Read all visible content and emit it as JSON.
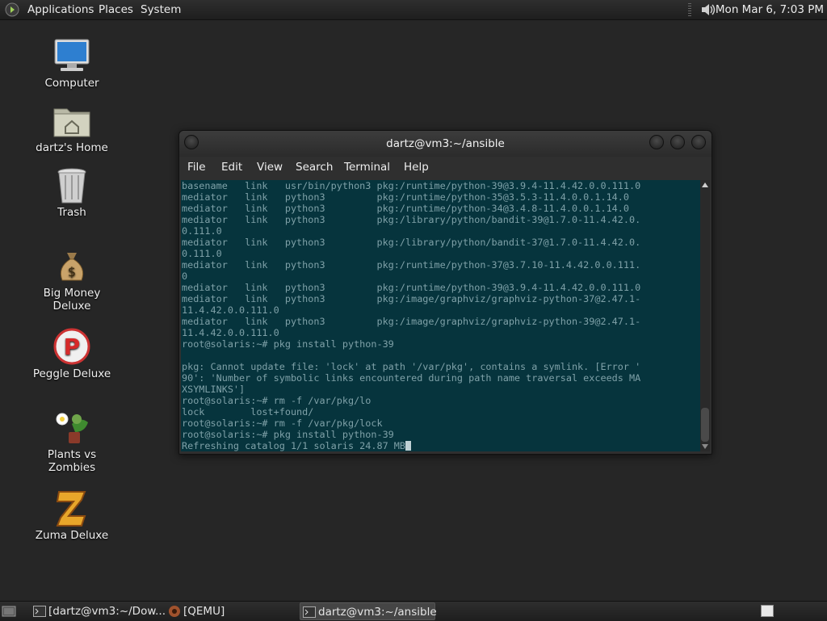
{
  "top_panel": {
    "menus": [
      "Applications",
      "Places",
      "System"
    ],
    "clock": "Mon Mar  6,  7:03 PM"
  },
  "desktop_icons": [
    {
      "label": "Computer",
      "icon": "computer-icon"
    },
    {
      "label": "dartz's Home",
      "icon": "home-folder-icon"
    },
    {
      "label": "Trash",
      "icon": "trash-icon"
    },
    {
      "label": "Big Money Deluxe",
      "icon": "money-bag-icon"
    },
    {
      "label": "Peggle Deluxe",
      "icon": "peggle-icon"
    },
    {
      "label": "Plants vs Zombies",
      "icon": "plants-vs-zombies-icon"
    },
    {
      "label": "Zuma Deluxe",
      "icon": "zuma-icon"
    }
  ],
  "terminal": {
    "title": "dartz@vm3:~/ansible",
    "menu": [
      "File",
      "Edit",
      "View",
      "Search",
      "Terminal",
      "Help"
    ],
    "lines": [
      "basename   link   usr/bin/python3 pkg:/runtime/python-39@3.9.4-11.4.42.0.0.111.0",
      "mediator   link   python3         pkg:/runtime/python-35@3.5.3-11.4.0.0.1.14.0",
      "mediator   link   python3         pkg:/runtime/python-34@3.4.8-11.4.0.0.1.14.0",
      "mediator   link   python3         pkg:/library/python/bandit-39@1.7.0-11.4.42.0.",
      "0.111.0",
      "mediator   link   python3         pkg:/library/python/bandit-37@1.7.0-11.4.42.0.",
      "0.111.0",
      "mediator   link   python3         pkg:/runtime/python-37@3.7.10-11.4.42.0.0.111.",
      "0",
      "mediator   link   python3         pkg:/runtime/python-39@3.9.4-11.4.42.0.0.111.0",
      "mediator   link   python3         pkg:/image/graphviz/graphviz-python-37@2.47.1-",
      "11.4.42.0.0.111.0",
      "mediator   link   python3         pkg:/image/graphviz/graphviz-python-39@2.47.1-",
      "11.4.42.0.0.111.0",
      "root@solaris:~# pkg install python-39",
      "",
      "pkg: Cannot update file: 'lock' at path '/var/pkg', contains a symlink. [Error '",
      "90': 'Number of symbolic links encountered during path name traversal exceeds MA",
      "XSYMLINKS']",
      "root@solaris:~# rm -f /var/pkg/lo",
      "lock        lost+found/",
      "root@solaris:~# rm -f /var/pkg/lock",
      "root@solaris:~# pkg install python-39"
    ],
    "last_line": "Refreshing catalog 1/1 solaris 24.87 MB"
  },
  "taskbar": {
    "tasks": [
      {
        "label": "[dartz@vm3:~/Dow...",
        "icon": "terminal-icon",
        "active": false
      },
      {
        "label": "[QEMU]",
        "icon": "qemu-icon",
        "active": false
      },
      {
        "label": "dartz@vm3:~/ansible",
        "icon": "terminal-icon",
        "active": true
      }
    ]
  }
}
